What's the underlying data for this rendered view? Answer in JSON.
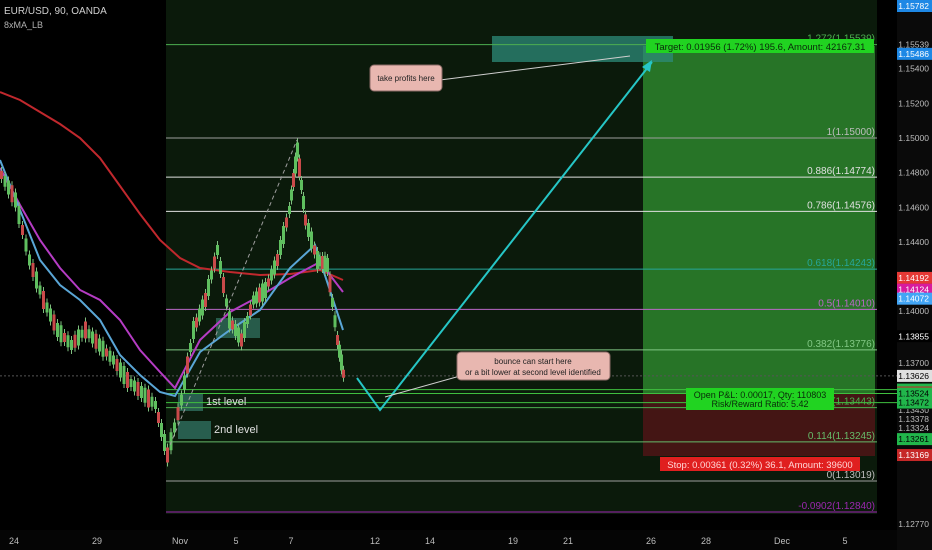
{
  "header": {
    "symbol_line": "EUR/USD, 90, OANDA",
    "indicator": "8xMA_LB"
  },
  "chart_data": {
    "type": "line",
    "title": "EUR/USD, 90, OANDA",
    "xlabel": "",
    "ylabel": "",
    "ylim": [
      1.1277,
      1.15782
    ],
    "grid": false,
    "x_ticks": [
      "24",
      "29",
      "Nov",
      "5",
      "7",
      "12",
      "14",
      "19",
      "21",
      "26",
      "28",
      "Dec",
      "5"
    ],
    "price_ticks": [
      1.15539,
      1.154,
      1.152,
      1.15,
      1.148,
      1.146,
      1.144,
      1.14,
      1.137,
      1.1343,
      1.13378,
      1.13324,
      1.1277
    ],
    "price_tags": [
      {
        "label": "1.15782",
        "price": 1.15782,
        "color": "#1e88e5"
      },
      {
        "label": "1.15486",
        "price": 1.15486,
        "color": "#1e88e5"
      },
      {
        "label": "1.14192",
        "price": 1.14192,
        "color": "#e53935"
      },
      {
        "label": "1.14124",
        "price": 1.14124,
        "color": "#d81b9e"
      },
      {
        "label": "1.14072",
        "price": 1.14072,
        "color": "#42a5f5"
      },
      {
        "label": "1.13855",
        "price": 1.13855,
        "color": "#000000"
      },
      {
        "label": "1.13626",
        "price": 1.13626,
        "color": "#e0e0e0"
      },
      {
        "label": "1.13547",
        "price": 1.13547,
        "color": "#21b64b"
      },
      {
        "label": "50:21",
        "price": 1.1347,
        "color": "#000000"
      },
      {
        "label": "1.13530",
        "price": 1.1353,
        "color": "#c62828"
      },
      {
        "label": "1.13524",
        "price": 1.13524,
        "color": "#21b64b"
      },
      {
        "label": "1.13472",
        "price": 1.13472,
        "color": "#21b64b"
      },
      {
        "label": "1.13261",
        "price": 1.13261,
        "color": "#21b64b"
      },
      {
        "label": "1.13169",
        "price": 1.13169,
        "color": "#c62828"
      }
    ],
    "fib_levels": [
      {
        "label": "1.272(1.15539)",
        "ratio": 1.272,
        "price": 1.15539,
        "color": "#4caf50"
      },
      {
        "label": "1(1.15000)",
        "ratio": 1,
        "price": 1.15,
        "color": "#9e9e9e"
      },
      {
        "label": "0.886(1.14774)",
        "ratio": 0.886,
        "price": 1.14774,
        "color": "#e0e0e0"
      },
      {
        "label": "0.786(1.14576)",
        "ratio": 0.786,
        "price": 1.14576,
        "color": "#e0e0e0"
      },
      {
        "label": "0.618(1.14243)",
        "ratio": 0.618,
        "price": 1.14243,
        "color": "#26a69a"
      },
      {
        "label": "0.5(1.14010)",
        "ratio": 0.5,
        "price": 1.1401,
        "color": "#ba68c8"
      },
      {
        "label": "0.382(1.13776)",
        "ratio": 0.382,
        "price": 1.13776,
        "color": "#81c784"
      },
      {
        "label": "0.236(1.13443)",
        "ratio": 0.236,
        "price": 1.13443,
        "color": "#4caf50"
      },
      {
        "label": "0.114(1.13245)",
        "ratio": 0.114,
        "price": 1.13245,
        "color": "#66bb6a"
      },
      {
        "label": "0(1.13019)",
        "ratio": 0,
        "price": 1.13019,
        "color": "#9e9e9e"
      },
      {
        "label": "-0.0902(1.12840)",
        "ratio": -0.0902,
        "price": 1.1284,
        "color": "#9c27b0"
      }
    ],
    "series": [
      {
        "name": "EUR/USD",
        "color": "#66bb6a"
      }
    ],
    "trade": {
      "target_text": "Target: 0.01956 (1.72%) 195.6, Amount: 42167.31",
      "stop_text": "Stop: 0.00361 (0.32%) 36.1, Amount: 39600",
      "pnl_text": "Open P&L: 0.00017, Qty: 110803",
      "rr_text": "Risk/Reward Ratio: 5.42"
    },
    "annotations": [
      {
        "text": "take profits here"
      },
      {
        "text": "bounce can start here"
      },
      {
        "text": "or a bit lower at second level identified"
      },
      {
        "text": "1st level"
      },
      {
        "text": "2nd level"
      }
    ]
  }
}
